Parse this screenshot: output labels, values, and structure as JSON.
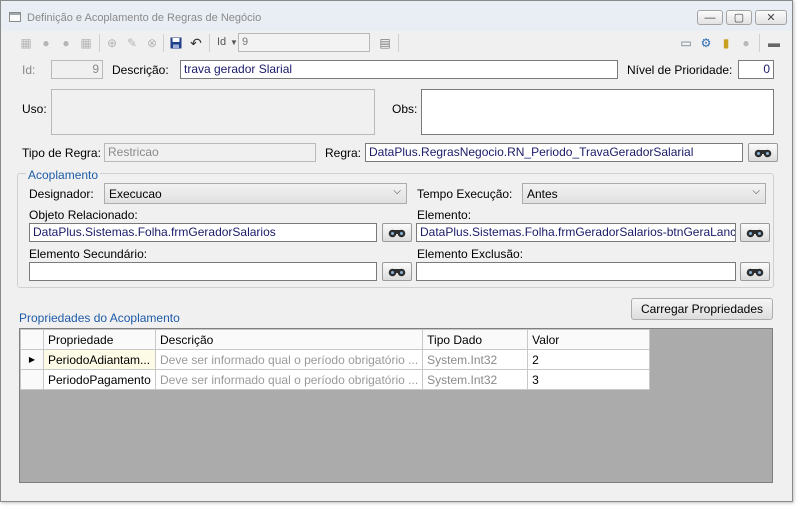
{
  "window": {
    "title": "Definição e Acoplamento de Regras de Negócio",
    "controls": {
      "minimize": "—",
      "maximize": "▢",
      "close": "✕"
    }
  },
  "toolbar": {
    "id_label": "Id",
    "id_value": "9"
  },
  "form": {
    "id_label": "Id:",
    "id_value": "9",
    "descricao_label": "Descrição:",
    "descricao_value": "trava gerador Slarial",
    "prioridade_label": "Nível de Prioridade:",
    "prioridade_value": "0",
    "uso_label": "Uso:",
    "uso_value": "",
    "obs_label": "Obs:",
    "obs_value": "",
    "tipo_regra_label": "Tipo de Regra:",
    "tipo_regra_value": "Restricao",
    "regra_label": "Regra:",
    "regra_value": "DataPlus.RegrasNegocio.RN_Periodo_TravaGeradorSalarial"
  },
  "acoplamento": {
    "legend": "Acoplamento",
    "designador_label": "Designador:",
    "designador_value": "Execucao",
    "tempo_label": "Tempo Execução:",
    "tempo_value": "Antes",
    "objeto_label": "Objeto Relacionado:",
    "objeto_value": "DataPlus.Sistemas.Folha.frmGeradorSalarios",
    "elemento_label": "Elemento:",
    "elemento_value": "DataPlus.Sistemas.Folha.frmGeradorSalarios-btnGeraLancto",
    "elem_secundario_label": "Elemento Secundário:",
    "elem_secundario_value": "",
    "elem_exclusao_label": "Elemento Exclusão:",
    "elem_exclusao_value": ""
  },
  "propriedades": {
    "title": "Propriedades do Acoplamento",
    "load_button": "Carregar Propriedades",
    "columns": [
      "Propriedade",
      "Descrição",
      "Tipo Dado",
      "Valor"
    ],
    "rows": [
      {
        "marker": "▶",
        "propriedade": "PeriodoAdiantam...",
        "descricao": "Deve ser informado qual o período obrigatório ...",
        "tipo": "System.Int32",
        "valor": "2"
      },
      {
        "marker": "",
        "propriedade": "PeriodoPagamento",
        "descricao": "Deve ser informado qual o período obrigatório ...",
        "tipo": "System.Int32",
        "valor": "3"
      }
    ]
  }
}
